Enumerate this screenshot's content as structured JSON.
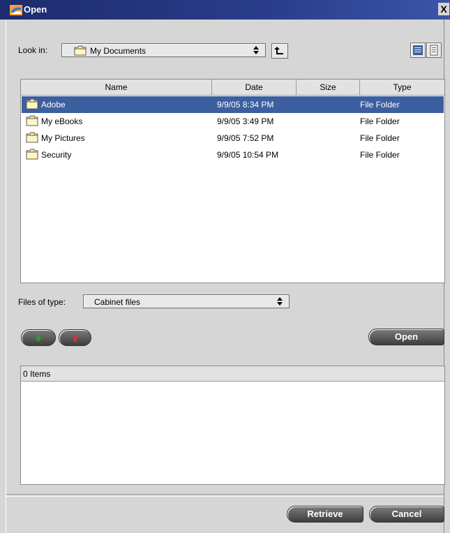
{
  "window": {
    "title": "Open",
    "close_label": "X"
  },
  "look_in": {
    "label": "Look in:",
    "value": "My Documents"
  },
  "file_list": {
    "columns": [
      "Name",
      "Date",
      "Size",
      "Type"
    ],
    "rows": [
      {
        "name": "Adobe",
        "date": "9/9/05 8:34 PM",
        "size": "",
        "type": "File Folder",
        "selected": true
      },
      {
        "name": "My eBooks",
        "date": "9/9/05 3:49 PM",
        "size": "",
        "type": "File Folder",
        "selected": false
      },
      {
        "name": "My Pictures",
        "date": "9/9/05 7:52 PM",
        "size": "",
        "type": "File Folder",
        "selected": false
      },
      {
        "name": "Security",
        "date": "9/9/05 10:54 PM",
        "size": "",
        "type": "File Folder",
        "selected": false
      }
    ]
  },
  "files_of_type": {
    "label": "Files of type:",
    "value": "Cabinet files"
  },
  "buttons": {
    "open": "Open",
    "retrieve": "Retrieve",
    "cancel": "Cancel"
  },
  "items_panel": {
    "header": "0 Items"
  },
  "icons": {
    "title": "app-logo-icon",
    "up": "up-folder-icon",
    "list_view": "list-view-icon",
    "details_view": "details-view-icon",
    "add": "add-down-arrow-icon",
    "remove": "remove-up-arrow-icon",
    "folder": "folder-icon"
  },
  "colors": {
    "titlebar": "#2a3d8c",
    "selection": "#3c5fa0",
    "add_arrow": "#2e9a2e",
    "remove_arrow": "#c23b3b"
  }
}
